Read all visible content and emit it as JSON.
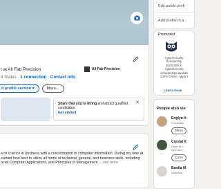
{
  "profile": {
    "headline": "t at All Fab Precision",
    "location_prefix": "d States · ",
    "connections": "1 connection",
    "separator": " · ",
    "contact_info": "Contact info",
    "company": "All Fab Precision",
    "add_section_label": "d profile section ▾",
    "more_label": "More..."
  },
  "hiring": {
    "bold": "Share that you’re hiring",
    "rest": " and attract qualified candidates.",
    "link": "Get started",
    "close": "✕"
  },
  "about": {
    "text": "e of science in business with a concentration in computer information. During my time at earned how best to utilize all forms of technical, general, and business skills, including nced Computer Applications, and Principles of Management ...",
    "see_more": "see more"
  },
  "right_top": {
    "edit_public": "Edit public profi",
    "add_profile": "Add profile in a"
  },
  "promo": {
    "label": "Promoted",
    "lines": [
      "Cybersecurity",
      "Scholarship",
      "$100,000 in",
      "Cybersecurity",
      "scholarships availab",
      "100% Online, apply t"
    ],
    "learn_more": "Learn more"
  },
  "people_also_viewed": {
    "title": "People also vie",
    "people": [
      {
        "name": "Englyn H",
        "desc": "Consultan",
        "button": "Mess",
        "color": "#c9a27e"
      },
      {
        "name": "Crystal K",
        "desc": "Open to o",
        "desc2": "Operation",
        "button": "Conn",
        "color": "#3f5a3a"
      },
      {
        "name": "Bardia M",
        "desc": "Administr",
        "color": "#d9d4cf"
      }
    ]
  },
  "icons": {
    "cover_edit": "camera-icon",
    "edit": "pencil-icon",
    "promo_logo": "owl-logo"
  }
}
